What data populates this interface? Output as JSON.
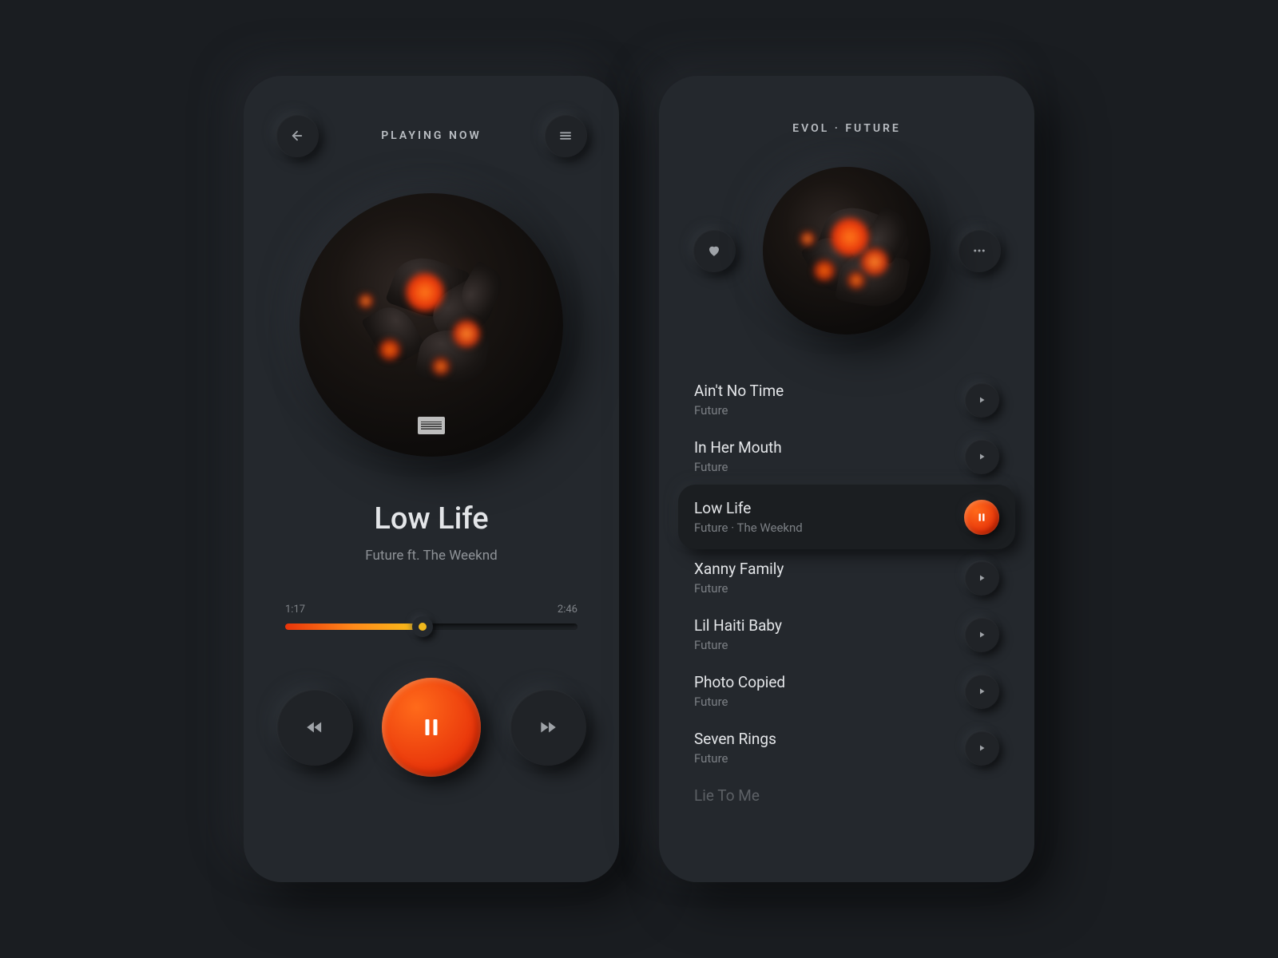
{
  "colors": {
    "accent": "#e8340a",
    "bg": "#24282d"
  },
  "nowPlaying": {
    "headerTitle": "PLAYING NOW",
    "songTitle": "Low Life",
    "songArtist": "Future ft. The Weeknd",
    "elapsed": "1:17",
    "duration": "2:46",
    "progressPercent": 47
  },
  "playlist": {
    "album": "EVOL",
    "artist": "FUTURE",
    "headerText": "EVOL  ·  FUTURE",
    "tracks": [
      {
        "title": "Ain't No Time",
        "artist": "Future",
        "active": false
      },
      {
        "title": "In Her Mouth",
        "artist": "Future",
        "active": false
      },
      {
        "title": "Low Life",
        "artist": "Future  ·  The Weeknd",
        "active": true
      },
      {
        "title": "Xanny Family",
        "artist": "Future",
        "active": false
      },
      {
        "title": "Lil Haiti Baby",
        "artist": "Future",
        "active": false
      },
      {
        "title": "Photo Copied",
        "artist": "Future",
        "active": false
      },
      {
        "title": "Seven Rings",
        "artist": "Future",
        "active": false
      },
      {
        "title": "Lie To Me",
        "artist": "",
        "active": false,
        "faded": true
      }
    ]
  },
  "icons": {
    "back": "back-arrow-icon",
    "menu": "hamburger-icon",
    "heart": "heart-icon",
    "more": "more-dots-icon",
    "prev": "previous-icon",
    "next": "next-icon",
    "pause": "pause-icon",
    "play": "play-icon"
  }
}
